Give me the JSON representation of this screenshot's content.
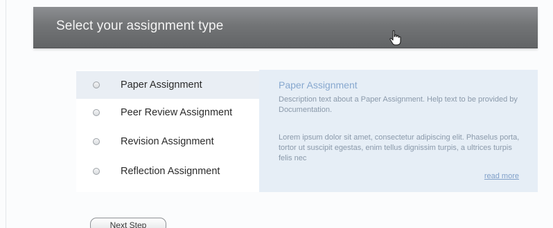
{
  "header": {
    "title": "Select your assignment type"
  },
  "options": [
    {
      "label": "Paper Assignment",
      "selected": true
    },
    {
      "label": "Peer Review Assignment",
      "selected": false
    },
    {
      "label": "Revision Assignment",
      "selected": false
    },
    {
      "label": "Reflection Assignment",
      "selected": false
    }
  ],
  "description": {
    "title": "Paper Assignment",
    "text": "Description text about a Paper Assignment. Help text to be provided by Documentation.",
    "body": "Lorem ipsum dolor sit amet, consectetur adipiscing elit. Phaselus porta, tortor ut suscipit egestas, enim tellus dignissim turpis, a ultrices turpis felis nec",
    "read_more": "read more"
  },
  "actions": {
    "next_label": "Next Step"
  },
  "colors": {
    "header_bg": "#727476",
    "panel_bg": "#e6eef6",
    "accent": "#87a8cf"
  },
  "icons": {
    "cursor": "hand-pointer-icon",
    "radio": "radio-button-icon"
  }
}
